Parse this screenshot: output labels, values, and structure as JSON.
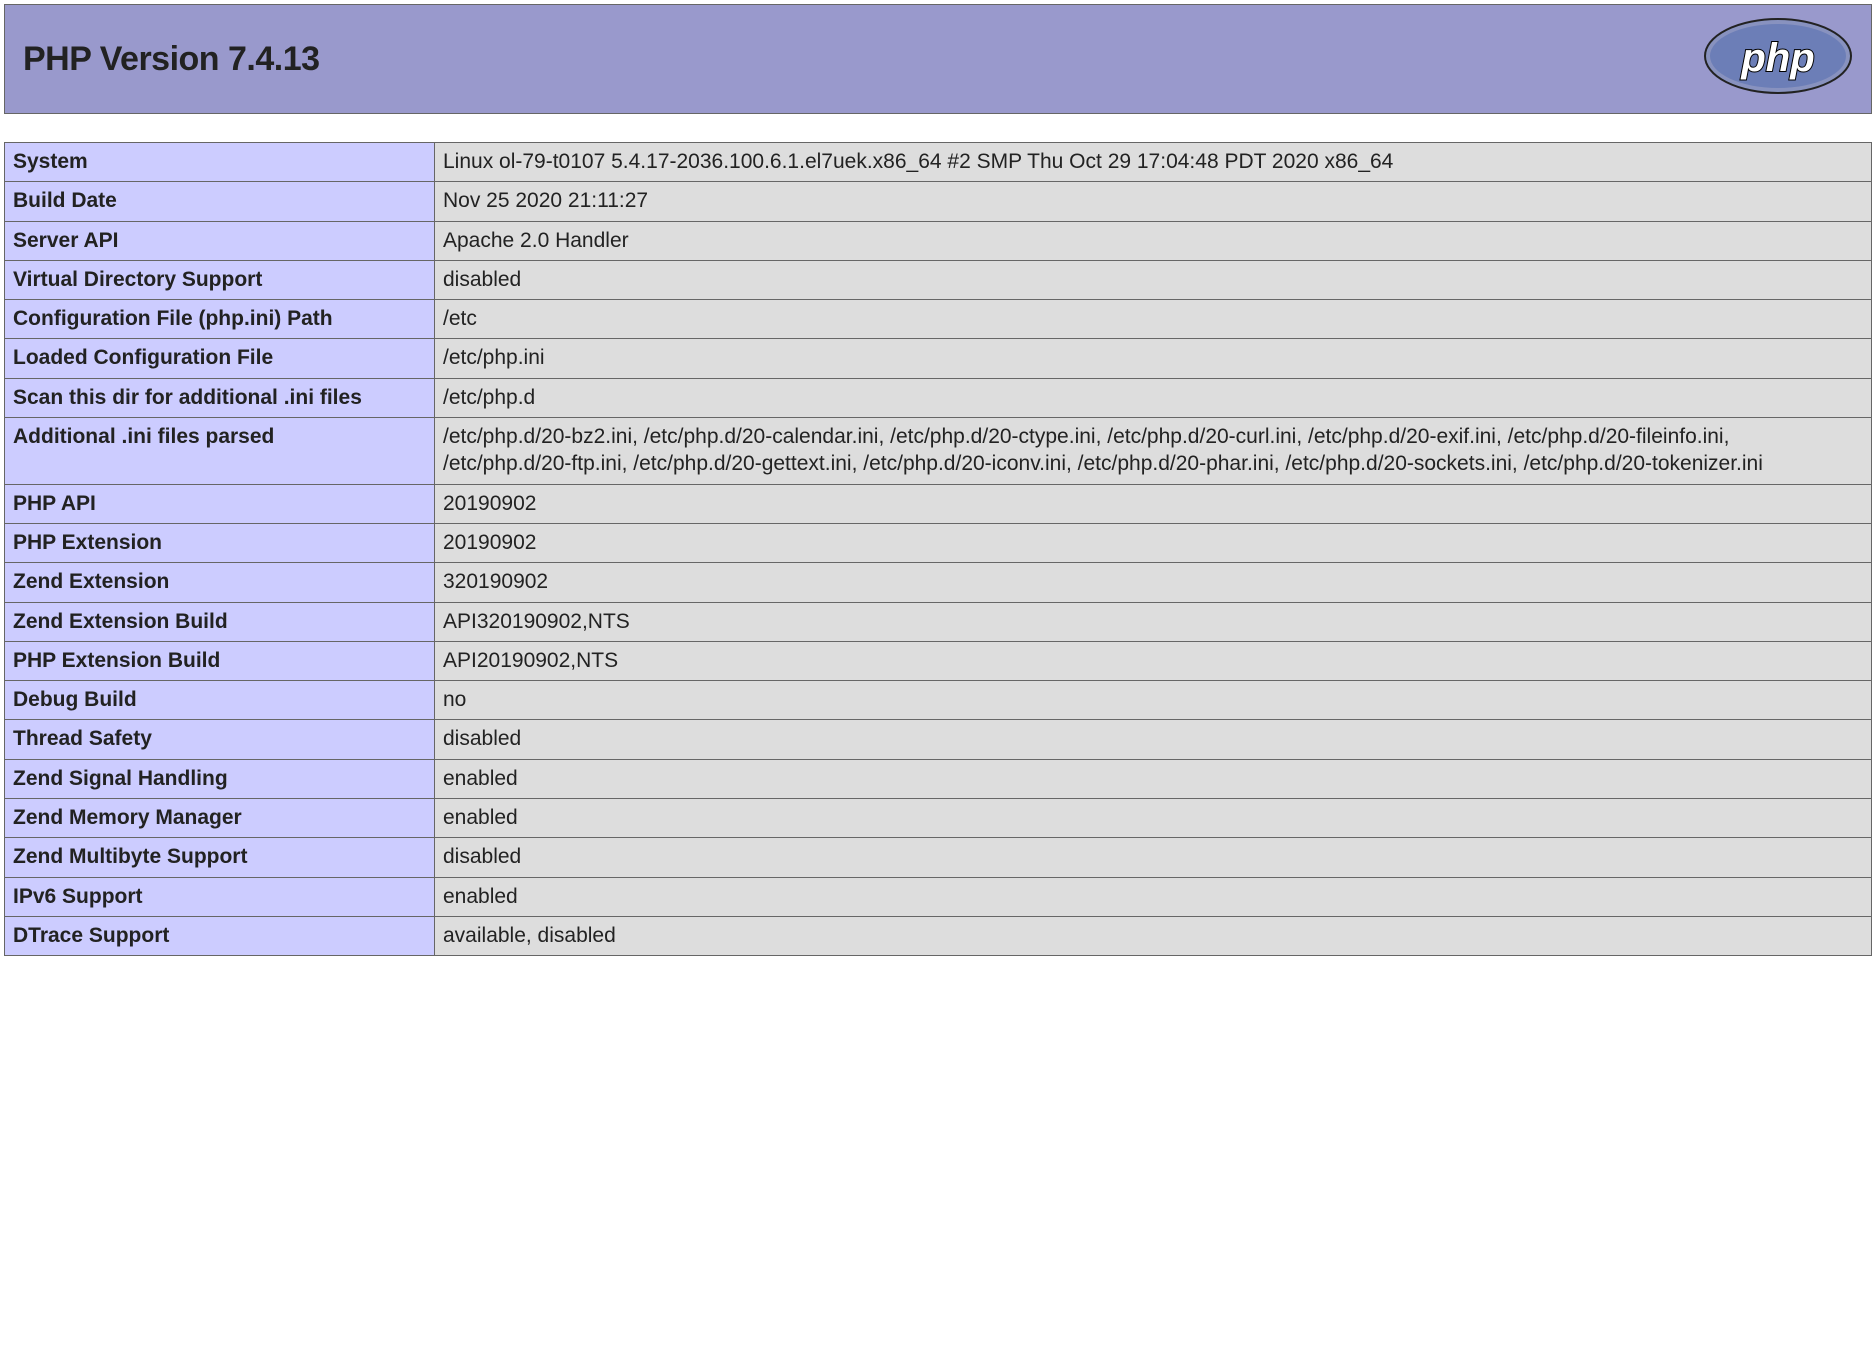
{
  "header": {
    "title": "PHP Version 7.4.13"
  },
  "rows": [
    {
      "key": "System",
      "value": "Linux ol-79-t0107 5.4.17-2036.100.6.1.el7uek.x86_64 #2 SMP Thu Oct 29 17:04:48 PDT 2020 x86_64"
    },
    {
      "key": "Build Date",
      "value": "Nov 25 2020 21:11:27"
    },
    {
      "key": "Server API",
      "value": "Apache 2.0 Handler"
    },
    {
      "key": "Virtual Directory Support",
      "value": "disabled"
    },
    {
      "key": "Configuration File (php.ini) Path",
      "value": "/etc"
    },
    {
      "key": "Loaded Configuration File",
      "value": "/etc/php.ini"
    },
    {
      "key": "Scan this dir for additional .ini files",
      "value": "/etc/php.d"
    },
    {
      "key": "Additional .ini files parsed",
      "value": "/etc/php.d/20-bz2.ini, /etc/php.d/20-calendar.ini, /etc/php.d/20-ctype.ini, /etc/php.d/20-curl.ini, /etc/php.d/20-exif.ini, /etc/php.d/20-fileinfo.ini, /etc/php.d/20-ftp.ini, /etc/php.d/20-gettext.ini, /etc/php.d/20-iconv.ini, /etc/php.d/20-phar.ini, /etc/php.d/20-sockets.ini, /etc/php.d/20-tokenizer.ini"
    },
    {
      "key": "PHP API",
      "value": "20190902"
    },
    {
      "key": "PHP Extension",
      "value": "20190902"
    },
    {
      "key": "Zend Extension",
      "value": "320190902"
    },
    {
      "key": "Zend Extension Build",
      "value": "API320190902,NTS"
    },
    {
      "key": "PHP Extension Build",
      "value": "API20190902,NTS"
    },
    {
      "key": "Debug Build",
      "value": "no"
    },
    {
      "key": "Thread Safety",
      "value": "disabled"
    },
    {
      "key": "Zend Signal Handling",
      "value": "enabled"
    },
    {
      "key": "Zend Memory Manager",
      "value": "enabled"
    },
    {
      "key": "Zend Multibyte Support",
      "value": "disabled"
    },
    {
      "key": "IPv6 Support",
      "value": "enabled"
    },
    {
      "key": "DTrace Support",
      "value": "available, disabled"
    }
  ]
}
